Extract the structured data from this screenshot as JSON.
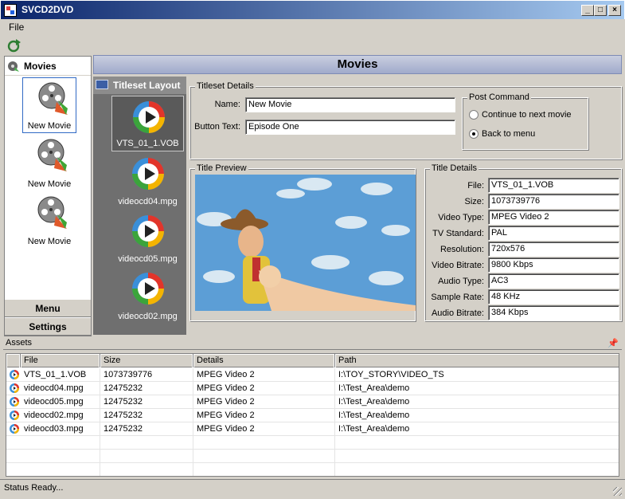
{
  "window": {
    "title": "SVCD2DVD"
  },
  "menu": {
    "file": "File"
  },
  "nav": {
    "movies_header": "Movies",
    "movies": [
      "New Movie",
      "New Movie",
      "New Movie"
    ],
    "menu_btn": "Menu",
    "settings_btn": "Settings"
  },
  "main": {
    "header": "Movies"
  },
  "titleset": {
    "header": "Titleset Layout",
    "items": [
      "VTS_01_1.VOB",
      "videocd04.mpg",
      "videocd05.mpg",
      "videocd02.mpg"
    ]
  },
  "titleset_details": {
    "legend": "Titleset Details",
    "name_label": "Name:",
    "name_value": "New Movie",
    "button_label": "Button Text:",
    "button_value": "Episode One"
  },
  "post_command": {
    "legend": "Post Command",
    "opt1": "Continue to next movie",
    "opt2": "Back to menu",
    "selected": "Back to menu"
  },
  "preview": {
    "legend": "Title Preview"
  },
  "title_details": {
    "legend": "Title Details",
    "fields": [
      {
        "label": "File:",
        "value": "VTS_01_1.VOB"
      },
      {
        "label": "Size:",
        "value": "1073739776"
      },
      {
        "label": "Video Type:",
        "value": "MPEG Video 2"
      },
      {
        "label": "TV Standard:",
        "value": "PAL"
      },
      {
        "label": "Resolution:",
        "value": "720x576"
      },
      {
        "label": "Video Bitrate:",
        "value": "9800 Kbps"
      },
      {
        "label": "Audio Type:",
        "value": "AC3"
      },
      {
        "label": "Sample Rate:",
        "value": "48 KHz"
      },
      {
        "label": "Audio Bitrate:",
        "value": "384 Kbps"
      }
    ]
  },
  "assets": {
    "header": "Assets",
    "pin": "📌",
    "columns": [
      "File",
      "Size",
      "Details",
      "Path"
    ],
    "rows": [
      [
        "VTS_01_1.VOB",
        "1073739776",
        "MPEG Video 2",
        "I:\\TOY_STORY\\VIDEO_TS"
      ],
      [
        "videocd04.mpg",
        "12475232",
        "MPEG Video 2",
        "I:\\Test_Area\\demo"
      ],
      [
        "videocd05.mpg",
        "12475232",
        "MPEG Video 2",
        "I:\\Test_Area\\demo"
      ],
      [
        "videocd02.mpg",
        "12475232",
        "MPEG Video 2",
        "I:\\Test_Area\\demo"
      ],
      [
        "videocd03.mpg",
        "12475232",
        "MPEG Video 2",
        "I:\\Test_Area\\demo"
      ]
    ]
  },
  "status": {
    "text": "Status Ready..."
  }
}
